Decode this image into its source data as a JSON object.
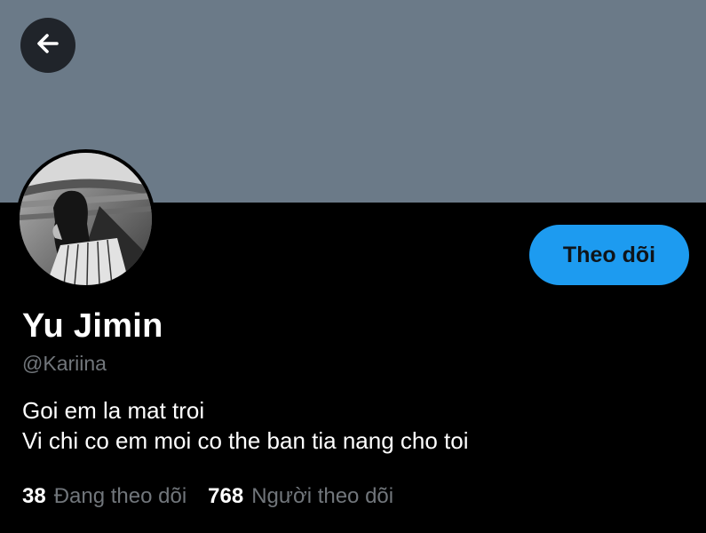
{
  "header": {
    "back_icon": "arrow-left-icon",
    "banner_color": "#6b7a88"
  },
  "profile": {
    "display_name": "Yu Jimin",
    "handle": "@Kariina",
    "bio_lines": [
      "Goi em la mat troi",
      "Vi chi co em moi co the ban tia nang cho toi"
    ],
    "follow_label": "Theo dõi",
    "accent_color": "#1d9bf0"
  },
  "stats": {
    "following_count": "38",
    "following_label": "Đang theo dõi",
    "followers_count": "768",
    "followers_label": "Người theo dõi"
  }
}
